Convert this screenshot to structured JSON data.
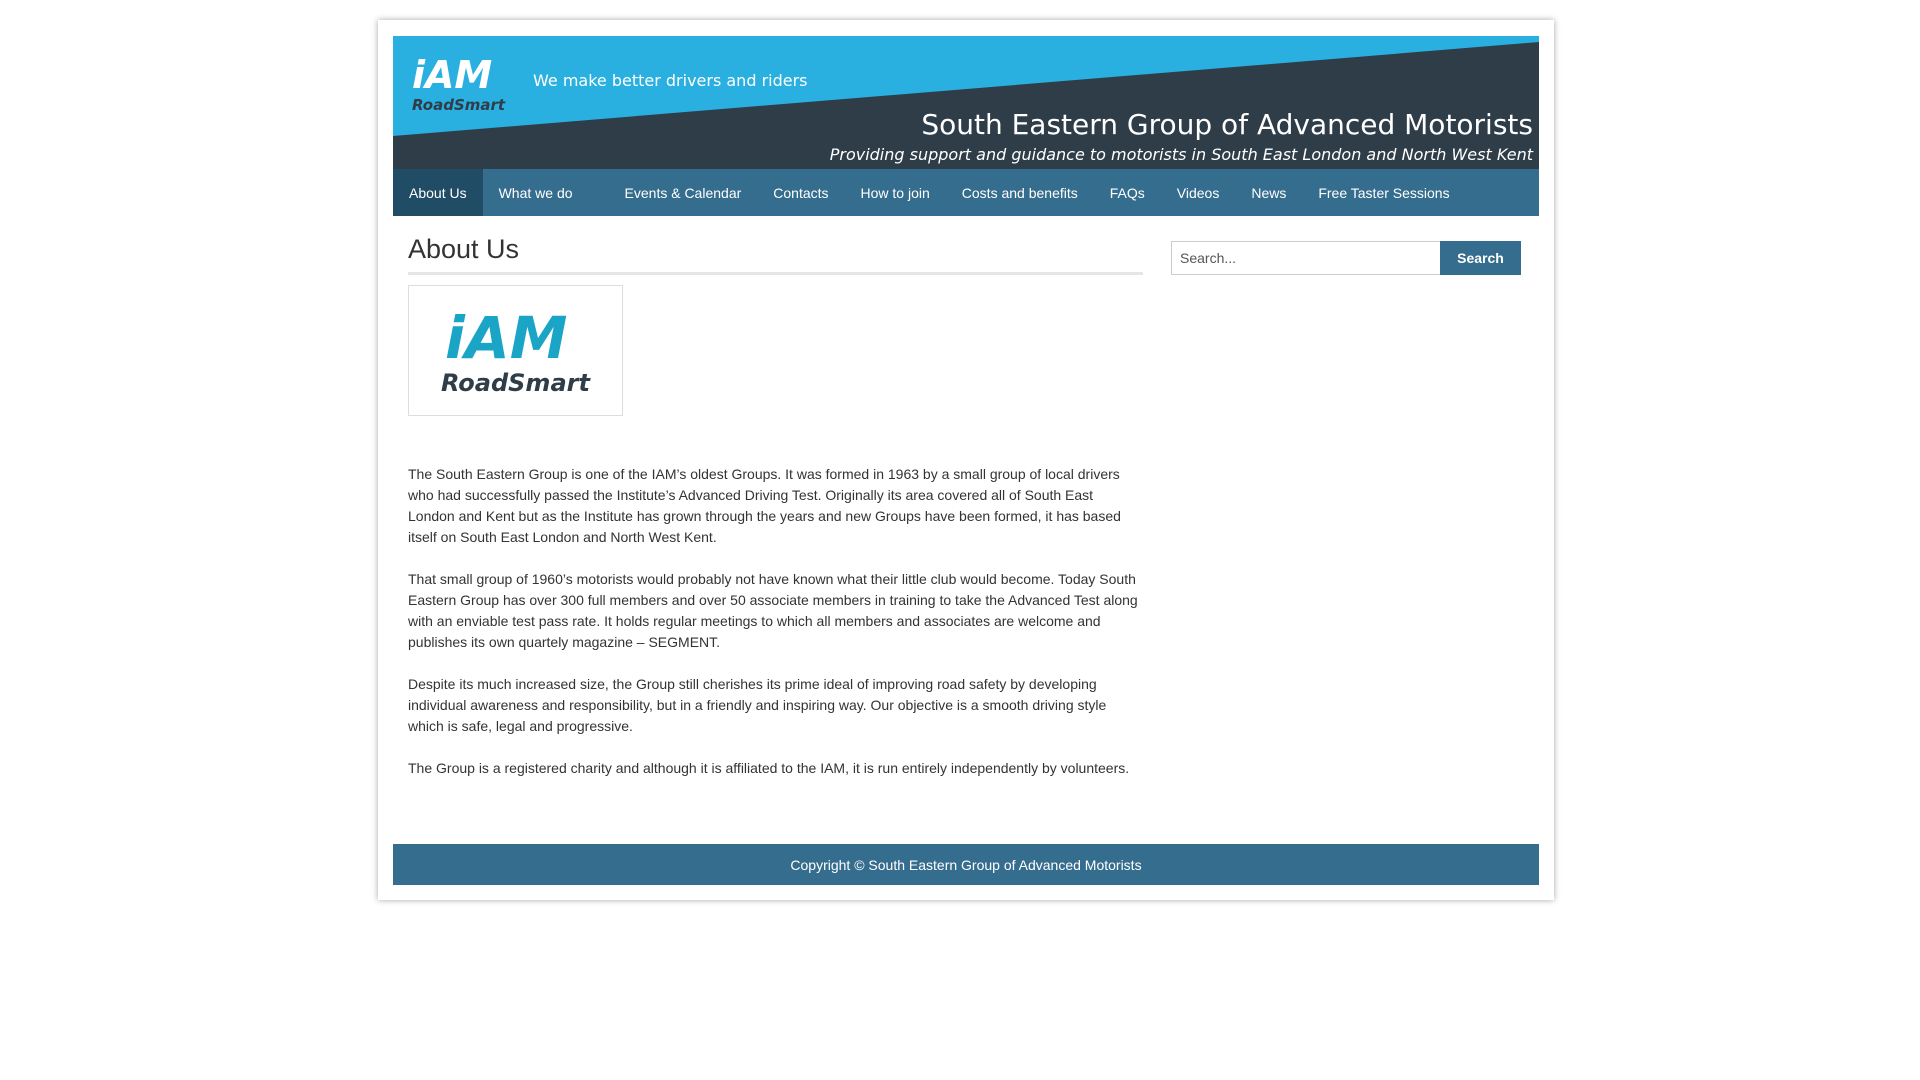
{
  "header": {
    "tagline": "We make better drivers and riders",
    "site_title": "South Eastern Group of Advanced Motorists",
    "site_subtitle": "Providing support and guidance to motorists in South East London and North West Kent",
    "logo_text_top": "iAM",
    "logo_text_bottom": "RoadSmart"
  },
  "nav": {
    "items": [
      {
        "label": "About Us",
        "active": true
      },
      {
        "label": "What we do"
      },
      {
        "label": "Events & Calendar"
      },
      {
        "label": "Contacts"
      },
      {
        "label": "How to join"
      },
      {
        "label": "Costs and benefits"
      },
      {
        "label": "FAQs"
      },
      {
        "label": "Videos"
      },
      {
        "label": "News"
      },
      {
        "label": "Free Taster Sessions"
      }
    ]
  },
  "main": {
    "title": "About Us",
    "logo": {
      "top": "iAM",
      "bottom": "RoadSmart"
    },
    "paragraphs": [
      "The South Eastern Group is one of the IAM’s oldest Groups.   It was formed in 1963 by a small group of local drivers who had successfully passed the Institute’s Advanced Driving Test.   Originally its area covered all of South East London and Kent but as the Institute has grown through the years and new Groups have been formed, it has based itself on South East London and North West Kent.",
      "That small group of 1960’s motorists would probably not have known what their little club would become.   Today South Eastern Group has over 300 full members and over 50 associate members in training to take the Advanced Test along with an enviable test pass rate.   It holds regular meetings to which all members and associates are welcome and publishes its own quartely magazine – SEGMENT.",
      "Despite its much increased size, the Group still cherishes its prime ideal of improving road safety by developing individual awareness and responsibility, but in a friendly and inspiring way.   Our objective is a smooth driving style which is safe, legal and progressive.",
      "The Group is a registered charity and although it is affiliated to the IAM, it is run entirely independently by volunteers."
    ]
  },
  "search": {
    "placeholder": "Search...",
    "button_label": "Search"
  },
  "footer": {
    "copyright": "Copyright © South Eastern Group of Advanced Motorists"
  },
  "colors": {
    "brand_blue": "#2ab0e0",
    "nav_blue": "#356d8e",
    "nav_active": "#214c65",
    "banner_dark": "#2f3d48",
    "logo_cyan": "#1aa5c6"
  }
}
